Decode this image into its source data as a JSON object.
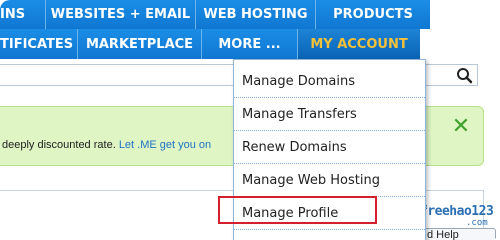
{
  "nav": {
    "row1": [
      "INS",
      "WEBSITES + EMAIL",
      "WEB HOSTING",
      "PRODUCTS"
    ],
    "row2": [
      "TIFICATES",
      "MARKETPLACE",
      "MORE ...",
      "MY ACCOUNT"
    ]
  },
  "notice": {
    "text": "deeply discounted rate. ",
    "link": "Let .ME get you on"
  },
  "account_menu": {
    "items": [
      "Manage Domains",
      "Manage Transfers",
      "Renew Domains",
      "Manage Web Hosting",
      "Manage Profile"
    ]
  },
  "help_tab": {
    "label": "d Help"
  },
  "watermark": {
    "text": "freehao123",
    "suffix": ".com"
  },
  "colors": {
    "nav_blue": "#1b8de6",
    "account_text": "#f3c13a",
    "notice_green": "#dff5c4",
    "close_green": "#3fa12e",
    "highlight_red": "#d3202c"
  },
  "icons": {
    "search": "magnifier-icon",
    "close": "close-x-icon"
  }
}
